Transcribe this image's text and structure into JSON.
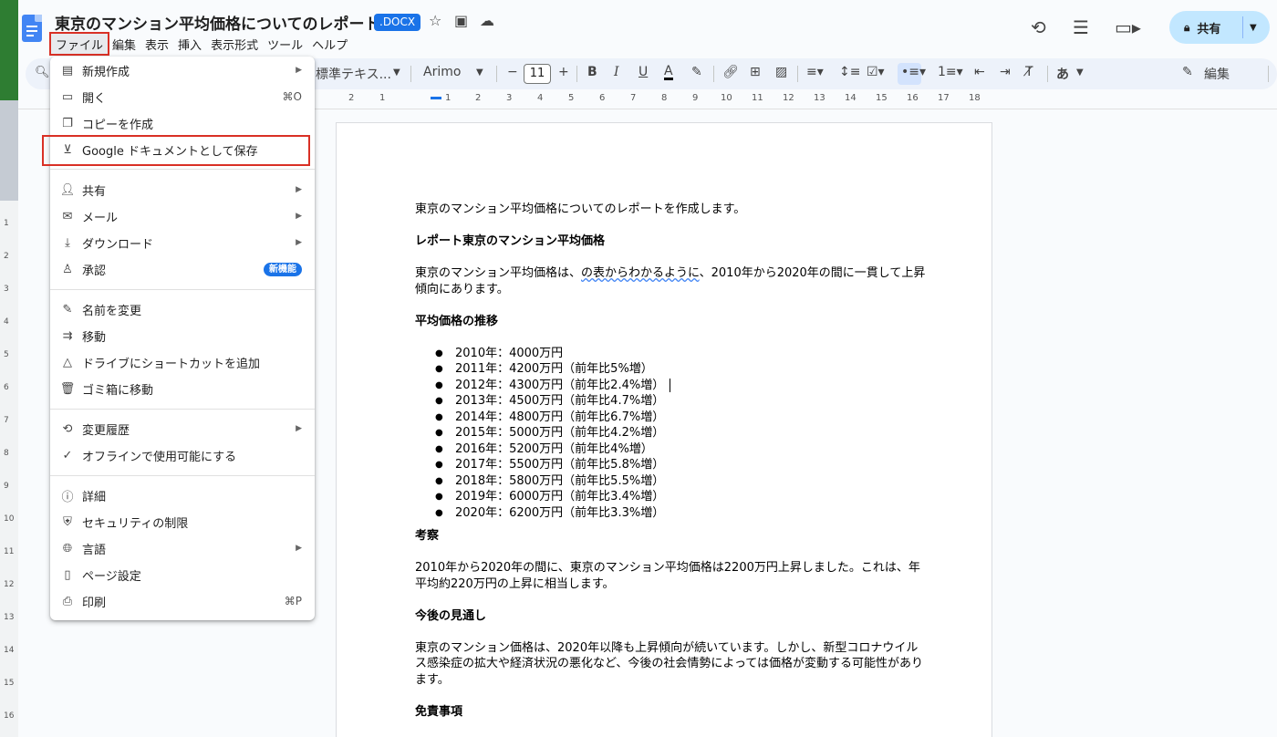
{
  "header": {
    "title": "東京のマンション平均価格についてのレポート",
    "badge": ".DOCX",
    "menus": [
      "ファイル",
      "編集",
      "表示",
      "挿入",
      "表示形式",
      "ツール",
      "ヘルプ"
    ],
    "share_label": "共有"
  },
  "toolbar": {
    "style": "標準テキス...",
    "font": "Arimo",
    "font_size": "11",
    "edit_mode": "編集",
    "input_mode": "あ"
  },
  "ruler": {
    "h_marks": [
      "2",
      "1",
      "1",
      "2",
      "3",
      "4",
      "5",
      "6",
      "7",
      "8",
      "9",
      "10",
      "11",
      "12",
      "13",
      "14",
      "15",
      "16",
      "17",
      "18"
    ],
    "v_marks": [
      "1",
      "2",
      "3",
      "4",
      "5",
      "6",
      "7",
      "8",
      "9",
      "10",
      "11",
      "12",
      "13",
      "14",
      "15",
      "16"
    ]
  },
  "file_menu": {
    "items": [
      {
        "icon": "new-doc-icon",
        "label": "新規作成",
        "submenu": true
      },
      {
        "icon": "folder-icon",
        "label": "開く",
        "shortcut": "⌘O"
      },
      {
        "icon": "copy-icon",
        "label": "コピーを作成"
      },
      {
        "icon": "save-as-icon",
        "label": "Google ドキュメントとして保存"
      },
      {
        "icon": "person-add-icon",
        "label": "共有",
        "submenu": true
      },
      {
        "icon": "mail-icon",
        "label": "メール",
        "submenu": true
      },
      {
        "icon": "download-icon",
        "label": "ダウンロード",
        "submenu": true
      },
      {
        "icon": "approval-icon",
        "label": "承認",
        "badge": "新機能"
      },
      {
        "icon": "pencil-icon",
        "label": "名前を変更"
      },
      {
        "icon": "move-icon",
        "label": "移動"
      },
      {
        "icon": "shortcut-icon",
        "label": "ドライブにショートカットを追加"
      },
      {
        "icon": "trash-icon",
        "label": "ゴミ箱に移動"
      },
      {
        "icon": "history-icon",
        "label": "変更履歴",
        "submenu": true
      },
      {
        "icon": "offline-icon",
        "label": "オフラインで使用可能にする"
      },
      {
        "icon": "info-icon",
        "label": "詳細"
      },
      {
        "icon": "security-icon",
        "label": "セキュリティの制限"
      },
      {
        "icon": "globe-icon",
        "label": "言語",
        "submenu": true
      },
      {
        "icon": "page-setup-icon",
        "label": "ページ設定"
      },
      {
        "icon": "print-icon",
        "label": "印刷",
        "shortcut": "⌘P"
      }
    ]
  },
  "document": {
    "intro": "東京のマンション平均価格についてのレポートを作成します。",
    "heading1": "レポート東京のマンション平均価格",
    "para1_a": "東京のマンション平均価格は、",
    "para1_b": "の表からわかるように",
    "para1_c": "、2010年から2020年の間に一貫して上昇傾向にあります。",
    "heading2": "平均価格の推移",
    "list": [
      "2010年：4000万円",
      "2011年：4200万円（前年比5%増）",
      "2012年：4300万円（前年比2.4%増）",
      "2013年：4500万円（前年比4.7%増）",
      "2014年：4800万円（前年比6.7%増）",
      "2015年：5000万円（前年比4.2%増）",
      "2016年：5200万円（前年比4%増）",
      "2017年：5500万円（前年比5.8%増）",
      "2018年：5800万円（前年比5.5%増）",
      "2019年：6000万円（前年比3.4%増）",
      "2020年：6200万円（前年比3.3%増）"
    ],
    "heading3": "考察",
    "para2": "2010年から2020年の間に、東京のマンション平均価格は2200万円上昇しました。これは、年平均約220万円の上昇に相当します。",
    "heading4": "今後の見通し",
    "para3": "東京のマンション価格は、2020年以降も上昇傾向が続いています。しかし、新型コロナウイルス感染症の拡大や経済状況の悪化など、今後の社会情勢によっては価格が変動する可能性があります。",
    "heading5": "免責事項"
  },
  "colors": {
    "accent": "#1a73e8",
    "highlight": "#d93025",
    "share_bg": "#c2e7ff"
  }
}
